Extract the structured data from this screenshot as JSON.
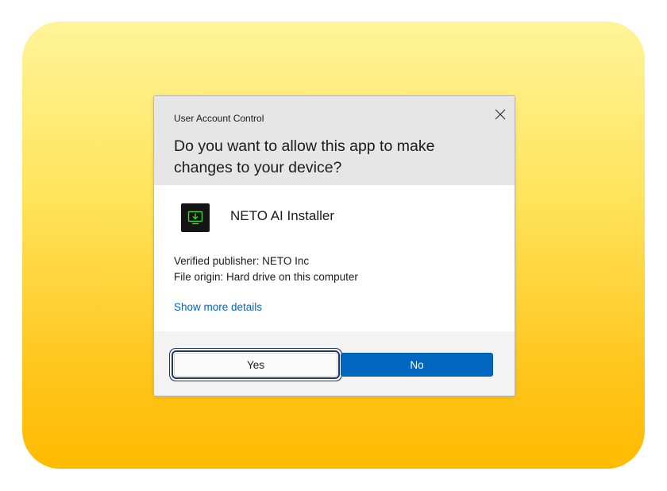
{
  "dialog": {
    "caption": "User Account Control",
    "question": "Do you want to allow this app to make changes to your device?",
    "app_name": "NETO AI Installer",
    "app_icon": "monitor-download-icon",
    "publisher": "Verified publisher: NETO Inc",
    "origin": "File origin: Hard drive on this computer",
    "details_link": "Show more details",
    "close_icon": "close-icon"
  },
  "buttons": {
    "yes_label": "Yes",
    "no_label": "No"
  },
  "colors": {
    "accent": "#0067c0",
    "header_bg": "#e6e6e6",
    "footer_bg": "#f3f3f3",
    "icon_green": "#3ad13a",
    "backdrop_top": "#fff49a",
    "backdrop_bottom": "#ffbb00"
  }
}
